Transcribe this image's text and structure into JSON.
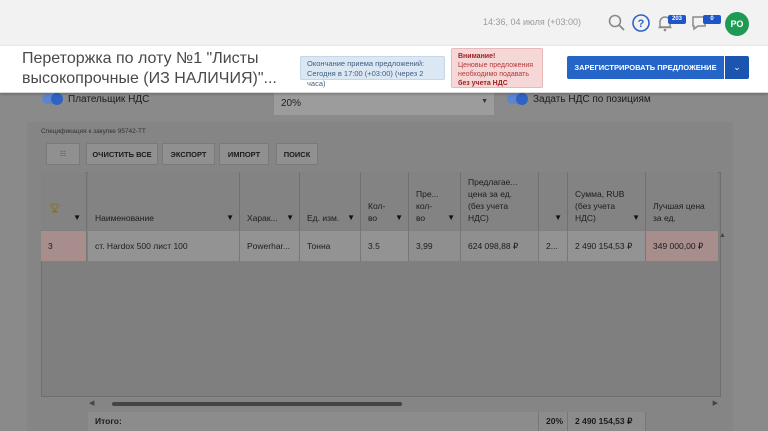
{
  "topbar": {
    "datetime": "14:36, 04 июля (+03:00)",
    "notifications_count": "203",
    "messages_count": "0",
    "avatar_initials": "РО"
  },
  "header": {
    "title": "Переторжка по лоту №1 \"Листы высокопрочные (ИЗ НАЛИЧИЯ)\"...",
    "deadline_line1": "Окончание приема предложений:",
    "deadline_line2": "Сегодня в 17:00 (+03:00) (через 2 часа)",
    "warning_title": "Внимание!",
    "warning_line1": "Ценовые предложения",
    "warning_line2": "необходимо подавать",
    "warning_line3": "без учета НДС",
    "register_button": "ЗАРЕГИСТРИРОВАТЬ ПРЕДЛОЖЕНИЕ",
    "register_dropdown": "⌄"
  },
  "form": {
    "vat_payer_label": "Плательщик НДС",
    "vat_value": "20%",
    "vat_by_position_label": "Задать НДС по позициям"
  },
  "spec": {
    "label": "Спецификация к закупке 95742-ТТ",
    "buttons": {
      "clear_all": "ОЧИСТИТЬ ВСЕ",
      "export": "ЭКСПОРТ",
      "import": "ИМПОРТ",
      "search": "ПОИСК"
    },
    "columns": {
      "name": "Наименование",
      "characteristics": "Харак...",
      "unit": "Ед. изм.",
      "qty_1": "Кол-",
      "qty_2": "во",
      "offer_qty_1": "Пре...",
      "offer_qty_2": "кол-",
      "offer_qty_3": "во",
      "offered_price_1": "Предлагае...",
      "offered_price_2": "цена за ед.",
      "offered_price_3": "(без учета",
      "offered_price_4": "НДС)",
      "sum_1": "Сумма, RUB",
      "sum_2": "(без учета",
      "sum_3": "НДС)",
      "best_price_1": "Лучшая цена",
      "best_price_2": "за ед."
    },
    "row": {
      "rank": "3",
      "name": "ст. Hardox 500 лист 100",
      "characteristics": "Powerhar...",
      "unit": "Тонна",
      "qty": "3.5",
      "offer_qty": "3,99",
      "offered_price": "624 098,88 ₽",
      "vat": "2...",
      "sum": "2 490 154,53 ₽",
      "best_price": "349 000,00 ₽"
    },
    "footer": {
      "total_label": "Итого:",
      "vat": "20%",
      "sum": "2 490 154,53 ₽"
    }
  }
}
